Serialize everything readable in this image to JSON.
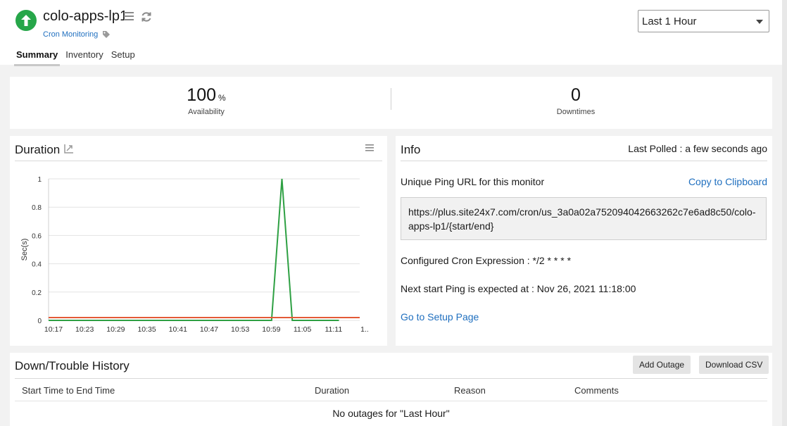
{
  "header": {
    "monitor_name": "colo-apps-lp1",
    "monitor_type": "Cron Monitoring",
    "tabs": [
      {
        "label": "Summary",
        "active": true
      },
      {
        "label": "Inventory",
        "active": false
      },
      {
        "label": "Setup",
        "active": false
      }
    ],
    "period": "Last 1 Hour",
    "status_color": "#26a649",
    "icons": [
      "arrow-up-icon",
      "menu-icon",
      "refresh-icon",
      "tag-icon",
      "chevron-down-icon"
    ]
  },
  "summary": {
    "availability_value": "100",
    "availability_unit": "%",
    "availability_label": "Availability",
    "downtimes_value": "0",
    "downtimes_label": "Downtimes"
  },
  "duration": {
    "title": "Duration",
    "icons": [
      "expand-chart-icon",
      "chart-menu-icon"
    ]
  },
  "chart_data": {
    "type": "line",
    "ylabel": "Sec(s)",
    "xlabel": "",
    "ylim": [
      0,
      1
    ],
    "y_ticks": [
      "0",
      "0.2",
      "0.4",
      "0.6",
      "0.8",
      "1"
    ],
    "x_tick_labels": [
      "10:17",
      "10:23",
      "10:29",
      "10:35",
      "10:41",
      "10:47",
      "10:53",
      "10:59",
      "11:05",
      "11:11",
      "1.."
    ],
    "grid": true,
    "series": [
      {
        "color": "#2ea043",
        "points": [
          [
            "10:17",
            0
          ],
          [
            "11:00",
            0
          ],
          [
            "11:02",
            1
          ],
          [
            "11:04",
            0
          ],
          [
            "11:13",
            0
          ]
        ]
      },
      {
        "color": "#e35a36",
        "points": [
          [
            "10:17",
            0.02
          ],
          [
            "11:17",
            0.02
          ]
        ]
      }
    ]
  },
  "info": {
    "title": "Info",
    "last_polled_label": "Last Polled :",
    "last_polled_value": "a few seconds ago",
    "ping_url_label": "Unique Ping URL for this monitor",
    "copy_label": "Copy to Clipboard",
    "ping_url": "https://plus.site24x7.com/cron/us_3a0a02a752094042663262c7e6ad8c50/colo-apps-lp1/{start/end}",
    "cron_label": "Configured Cron Expression :",
    "cron_value": "*/2 * * * *",
    "next_ping_label": "Next start Ping is expected at :",
    "next_ping_value": "Nov 26, 2021 11:18:00",
    "setup_link": "Go to Setup Page"
  },
  "history": {
    "title": "Down/Trouble History",
    "add_outage_label": "Add Outage",
    "download_csv_label": "Download CSV",
    "columns": [
      "Start Time to End Time",
      "Duration",
      "Reason",
      "Comments"
    ],
    "empty_message": "No outages for \"Last Hour\""
  }
}
